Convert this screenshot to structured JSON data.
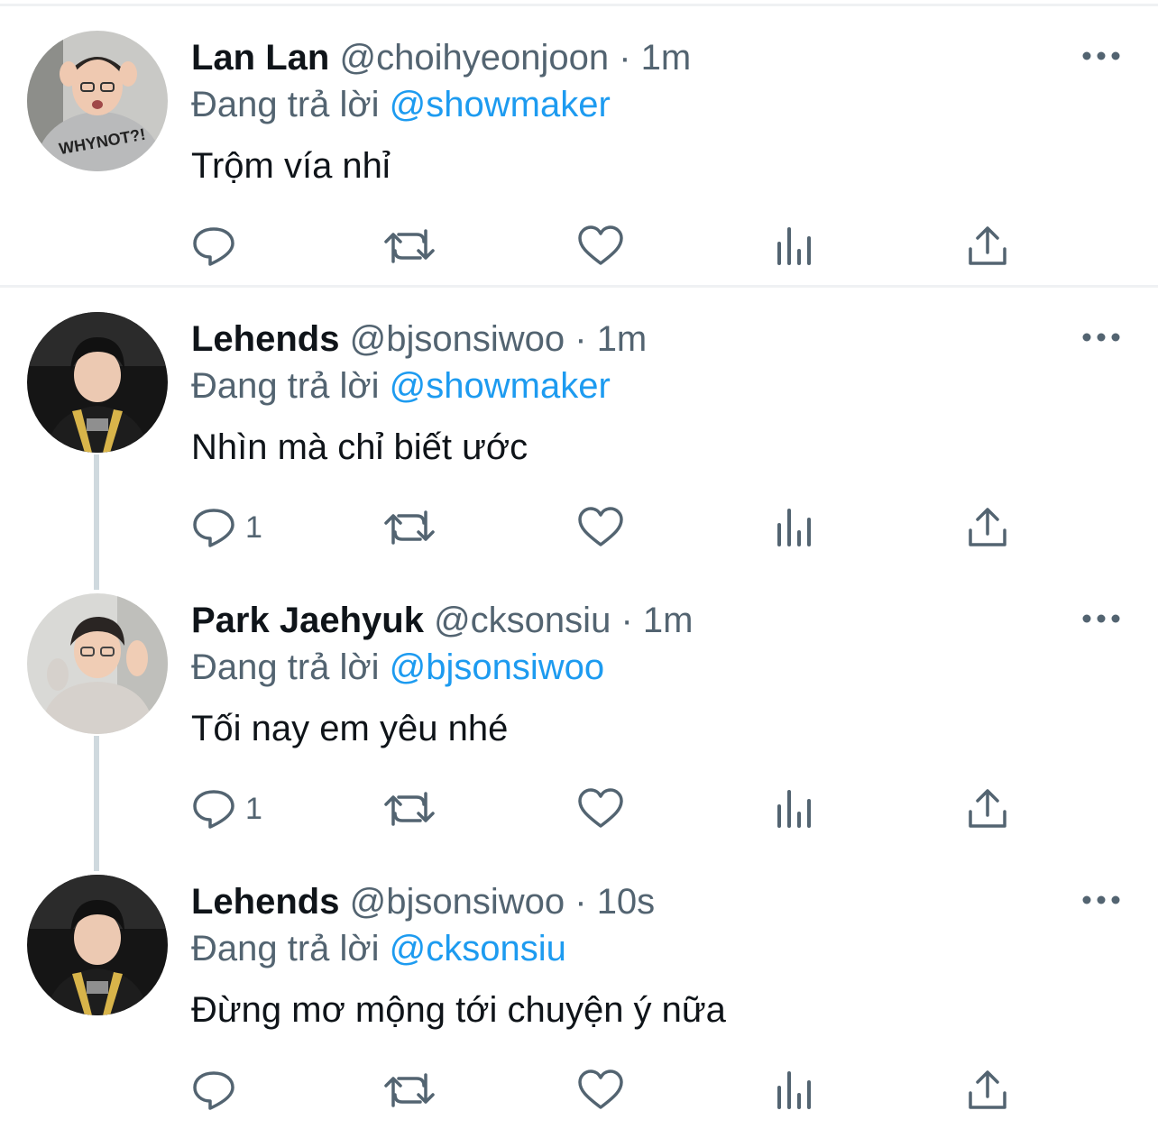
{
  "tweets": [
    {
      "name": "Lan Lan",
      "handle": "@choihyeonjoon",
      "separator": "·",
      "time": "1m",
      "reply_prefix": "Đang trả lời",
      "reply_to": "@showmaker",
      "text": "Trộm vía nhỉ",
      "avatar_shirt_text": "WHYNOT?!",
      "reply_count": ""
    },
    {
      "name": "Lehends",
      "handle": "@bjsonsiwoo",
      "separator": "·",
      "time": "1m",
      "reply_prefix": "Đang trả lời",
      "reply_to": "@showmaker",
      "text": "Nhìn mà chỉ biết ước",
      "reply_count": "1"
    },
    {
      "name": "Park Jaehyuk",
      "handle": "@cksonsiu",
      "separator": "·",
      "time": "1m",
      "reply_prefix": "Đang trả lời",
      "reply_to": "@bjsonsiwoo",
      "text": "Tối nay em yêu nhé",
      "reply_count": "1"
    },
    {
      "name": "Lehends",
      "handle": "@bjsonsiwoo",
      "separator": "·",
      "time": "10s",
      "reply_prefix": "Đang trả lời",
      "reply_to": "@cksonsiu",
      "text": "Đừng mơ mộng tới chuyện ý nữa",
      "reply_count": ""
    }
  ],
  "icons": [
    "reply-icon",
    "retweet-icon",
    "like-icon",
    "views-icon",
    "share-icon",
    "more-icon"
  ],
  "colors": {
    "text": "#0f1419",
    "secondary": "#536471",
    "link": "#1d9bf0",
    "divider": "#eff1f3",
    "thread_line": "#cfd9de"
  }
}
